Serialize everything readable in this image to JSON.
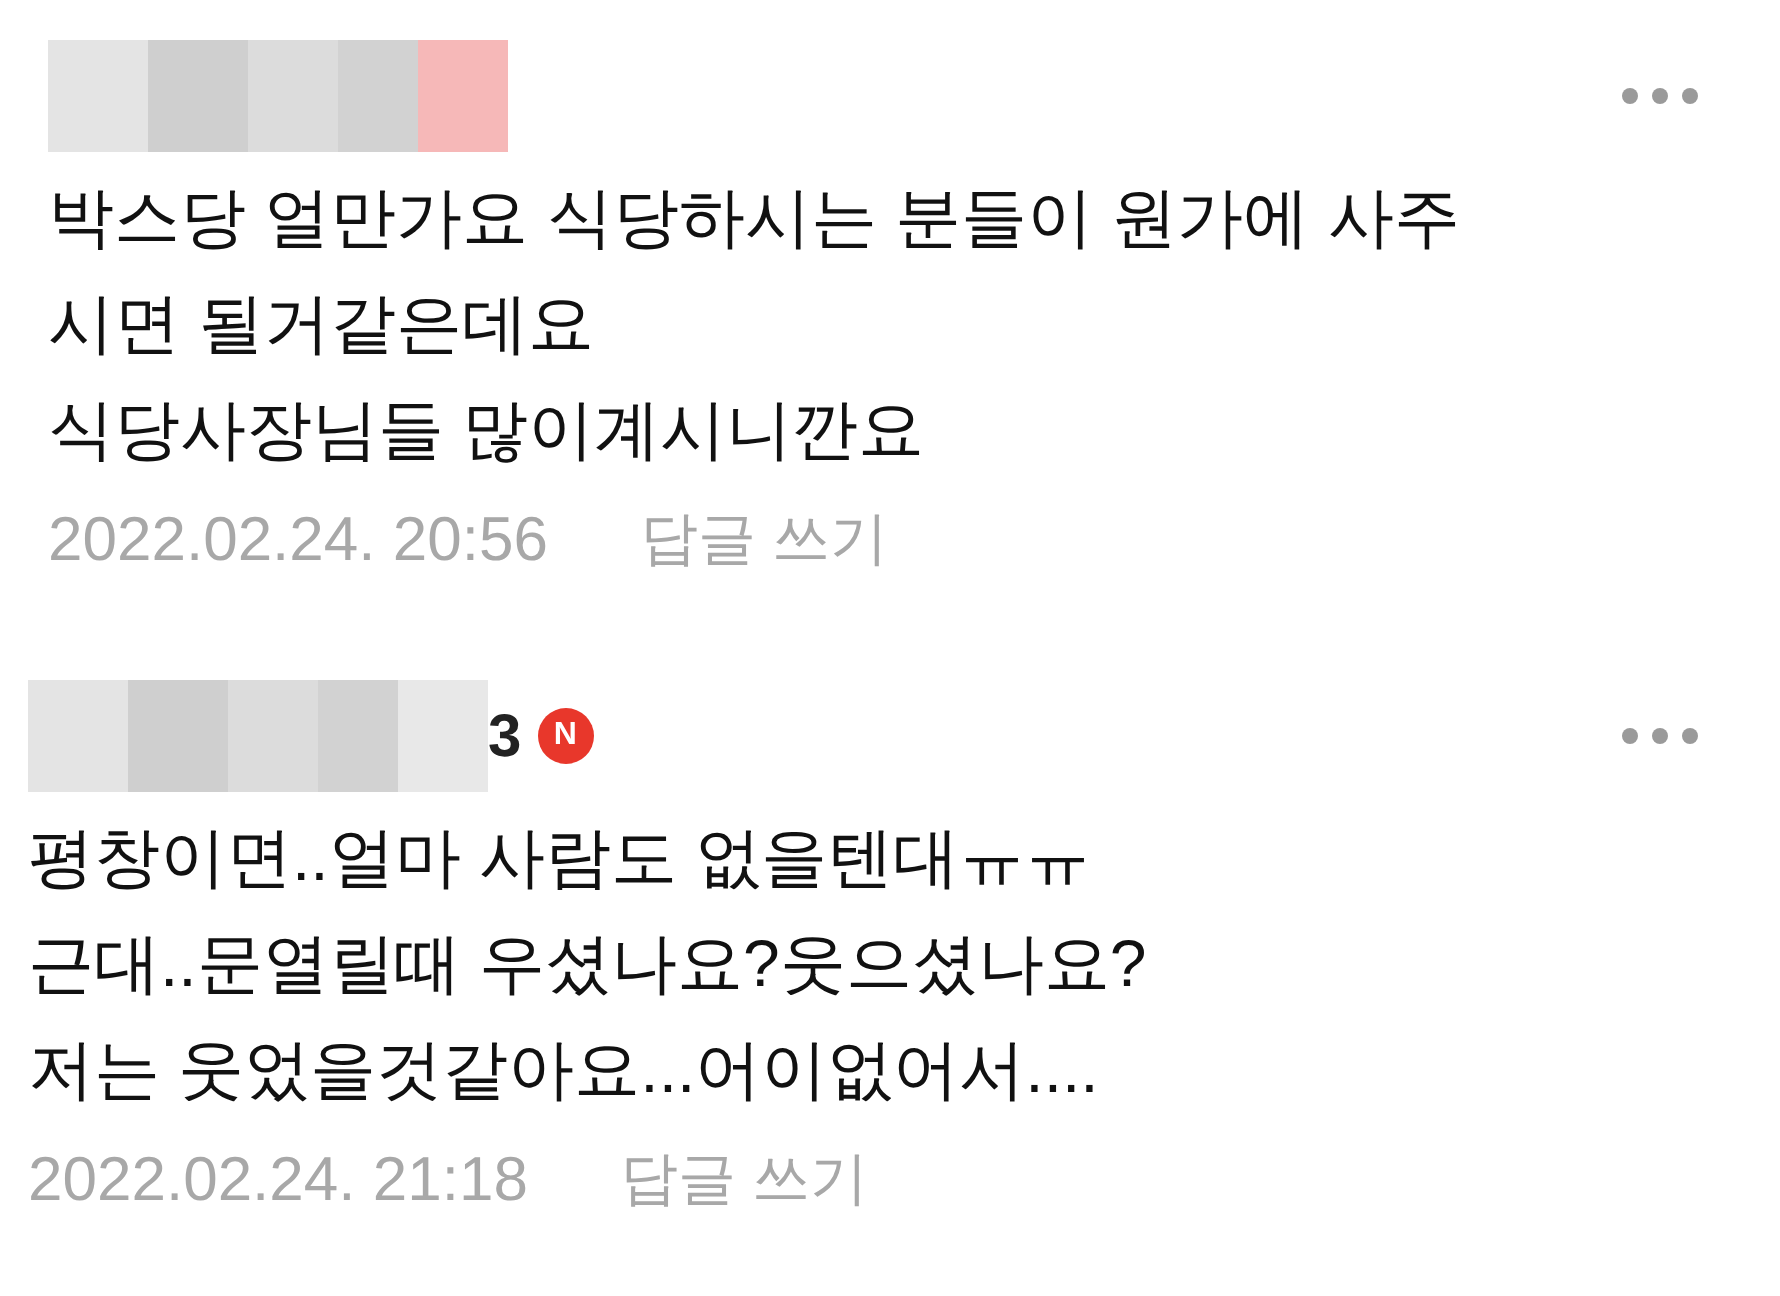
{
  "comments": [
    {
      "lines": [
        "박스당 얼만가요 식당하시는 분들이 원가에 사주",
        "시면 될거같은데요",
        "식당사장님들 많이계시니깐요"
      ],
      "date": "2022.02.24. 20:56",
      "reply": "답글 쓰기"
    },
    {
      "author_visible": "3",
      "badge": "N",
      "lines": [
        "평창이면..얼마 사람도 없을텐대ㅠㅠ",
        "근대..문열릴때 우셨나요?웃으셨나요?",
        "저는 웃었을것같아요...어이없어서...."
      ],
      "date": "2022.02.24. 21:18",
      "reply": "답글 쓰기"
    }
  ]
}
